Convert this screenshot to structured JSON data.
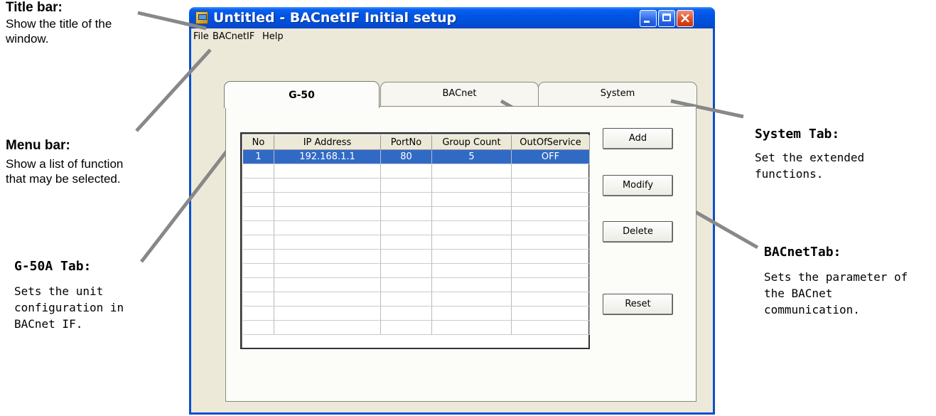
{
  "annotations": {
    "title_bar": {
      "heading": "Title bar:",
      "body": [
        "Show the title of the",
        "window."
      ]
    },
    "menu_bar": {
      "heading": "Menu bar:",
      "body": [
        "Show a list of function",
        "that may be selected."
      ]
    },
    "g50a_tab": {
      "heading": "G-50A Tab:",
      "body": [
        "Sets the unit",
        "configuration in",
        "BACnet IF."
      ]
    },
    "system_tab": {
      "heading": "System Tab:",
      "body": [
        "Set the extended",
        "functions."
      ]
    },
    "bacnet_tab": {
      "heading": "BACnetTab:",
      "body": [
        "Sets the parameter of",
        "the BACnet",
        "communication."
      ]
    }
  },
  "window": {
    "title": "Untitled - BACnetIF Initial setup",
    "menu": [
      "File",
      "BACnetIF",
      "Help"
    ],
    "tabs": [
      {
        "label": "G-50",
        "active": true
      },
      {
        "label": "BACnet",
        "active": false
      },
      {
        "label": "System",
        "active": false
      }
    ],
    "table": {
      "columns": [
        "No",
        "IP Address",
        "PortNo",
        "Group Count",
        "OutOfService"
      ],
      "rows": [
        [
          "1",
          "192.168.1.1",
          "80",
          "5",
          "OFF"
        ]
      ],
      "selected_row": 0
    },
    "buttons": {
      "add": "Add",
      "modify": "Modify",
      "delete": "Delete",
      "reset": "Reset"
    }
  },
  "colors": {
    "title_bar": "#0054e3",
    "window_face": "#ece9d8",
    "selection": "#316ac5",
    "leader_line": "#888888"
  }
}
